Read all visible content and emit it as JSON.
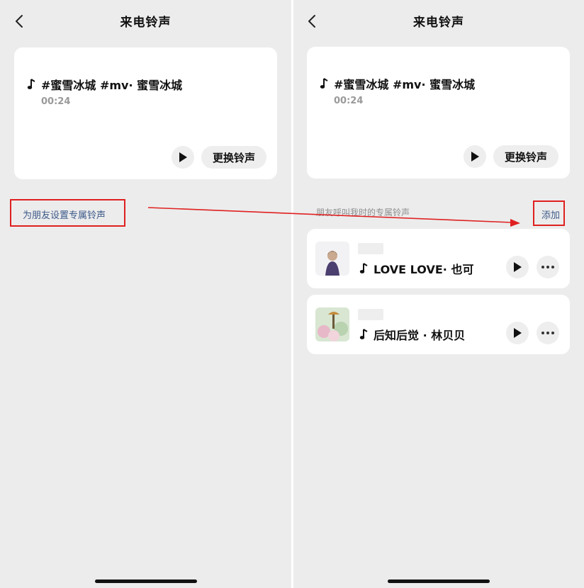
{
  "left": {
    "title": "来电铃声",
    "current": {
      "song": "#蜜雪冰城 #mv· 蜜雪冰城",
      "duration": "00:24",
      "change_label": "更换铃声"
    },
    "friend_link": "为朋友设置专属铃声"
  },
  "right": {
    "title": "来电铃声",
    "current": {
      "song": "#蜜雪冰城 #mv· 蜜雪冰城",
      "duration": "00:24",
      "change_label": "更换铃声"
    },
    "section_label": "朋友呼叫我时的专属铃声",
    "add_label": "添加",
    "items": [
      {
        "song": "LOVE LOVE· 也可"
      },
      {
        "song": "后知后觉 · 林贝贝"
      }
    ]
  },
  "colors": {
    "annotation": "#e02020",
    "link": "#3d5a8a",
    "background": "#ececec"
  },
  "icons": [
    "back-arrow-icon",
    "music-note-icon",
    "play-icon",
    "more-icon"
  ]
}
